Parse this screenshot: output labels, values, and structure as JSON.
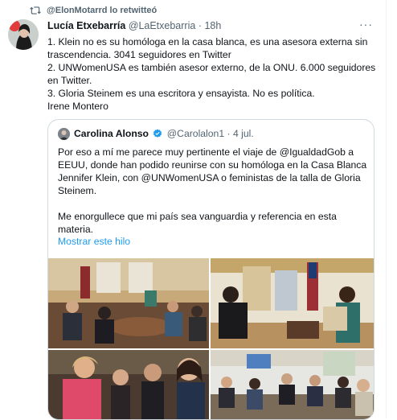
{
  "retweet": {
    "label": "@ElonMotarrd lo retwitteó",
    "icon": "retweet-icon"
  },
  "tweet": {
    "name": "Lucía Etxebarría",
    "handle": "@LaEtxebarria",
    "time": "· 18h",
    "more": "···",
    "lines": [
      "1. Klein no es su homóloga en la casa blanca, es una asesora externa sin",
      "trascendencia. 3041 seguidores en Twitter",
      "2. UNWomenUSA es también asesor externo, de la ONU. 6.000 seguidores",
      "en Twitter.",
      "3. Gloria Steinem es una escritora y ensayista. No es política.",
      "Irene Montero"
    ]
  },
  "quote": {
    "name": "Carolina Alonso",
    "handle": "@Carolalon1",
    "time": "· 4 jul.",
    "lines": [
      "Por eso a mí me parece muy pertinente el viaje de @IgualdadGob a",
      "EEUU, donde han podido reunirse con su homóloga en la Casa Blanca",
      "Jennifer Klein, con @UNWomenUSA o feministas de la talla de Gloria",
      "Steinem.",
      "",
      "Me enorgullece que mi país sea vanguardia y referencia en esta",
      "materia."
    ],
    "show_thread": "Mostrar este hilo"
  },
  "colors": {
    "accent": "#1d9bf0",
    "text": "#0f1419",
    "muted": "#536471",
    "border": "#cfd9de"
  }
}
